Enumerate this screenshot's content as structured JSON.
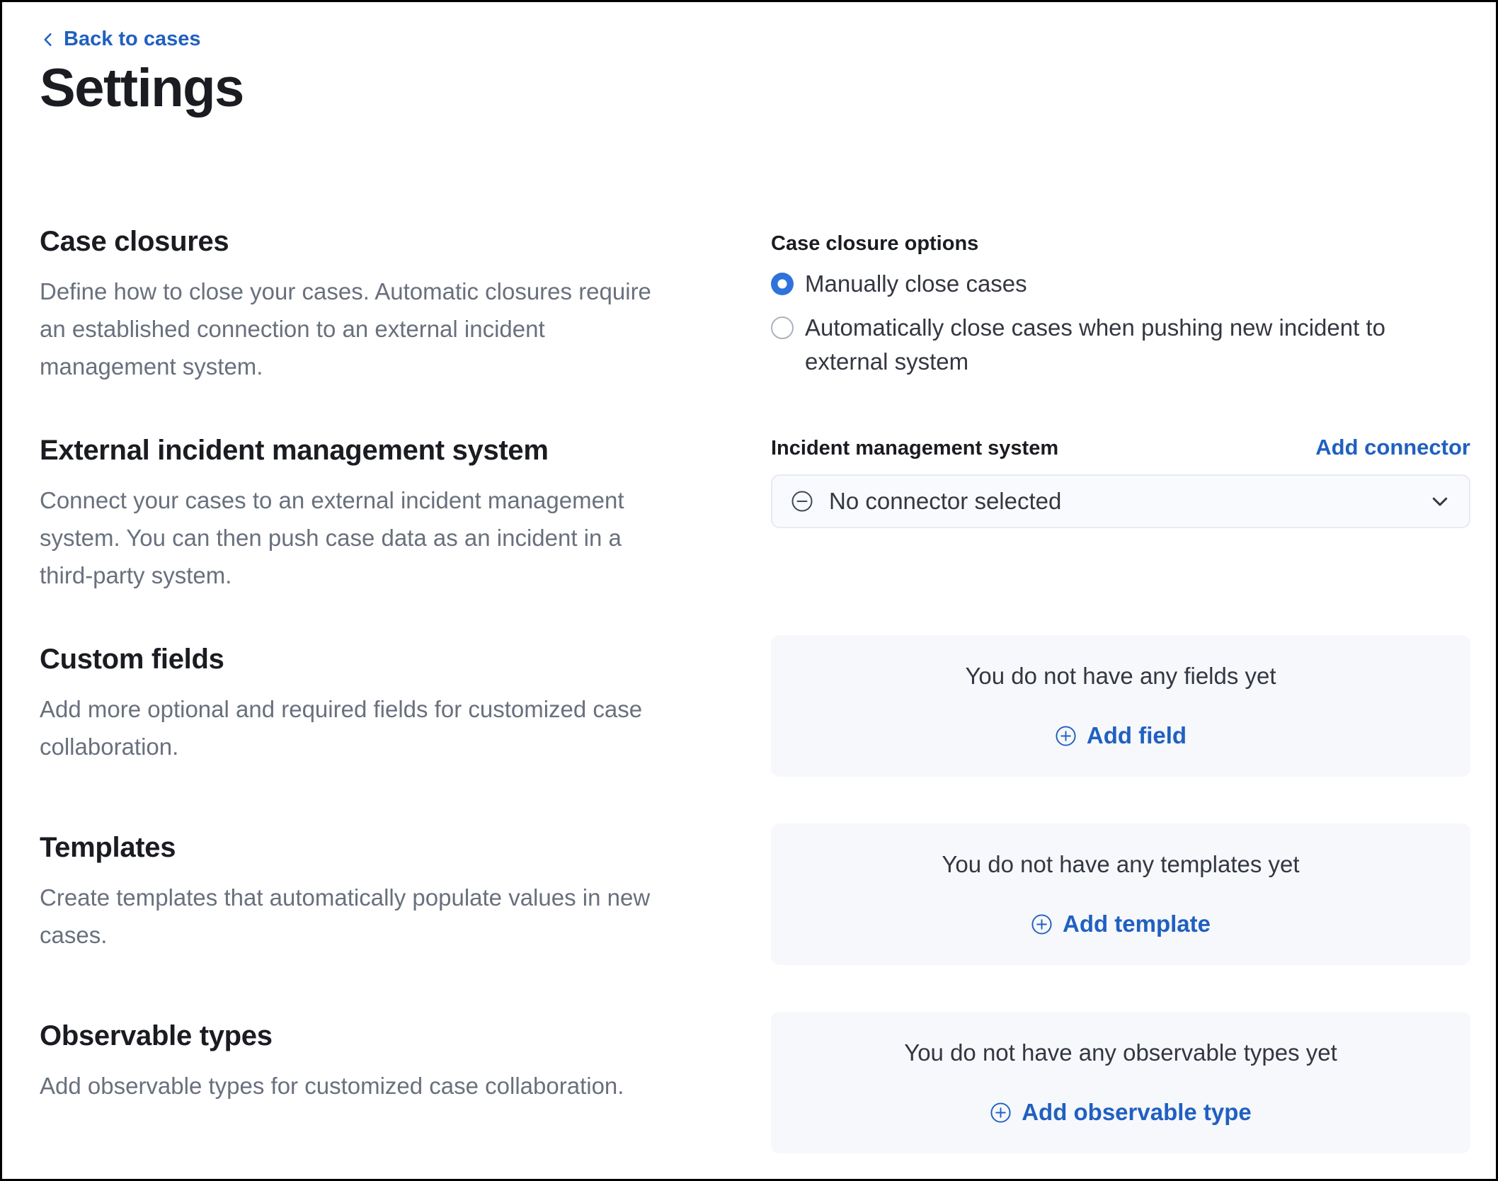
{
  "header": {
    "back_label": "Back to cases",
    "title": "Settings"
  },
  "colors": {
    "link_blue": "#2060C0",
    "radio_selected_blue": "#2E73D9",
    "panel_background": "#F6F8FC",
    "heading_text": "#1A1C21",
    "body_text": "#343741",
    "subdued_text": "#69707D"
  },
  "sections": {
    "case_closures": {
      "heading": "Case closures",
      "description": "Define how to close your cases. Automatic closures require an established connection to an external incident management system.",
      "options_label": "Case closure options",
      "radios": [
        {
          "label": "Manually close cases",
          "selected": true
        },
        {
          "label": "Automatically close cases when pushing new incident to external system",
          "selected": false
        }
      ]
    },
    "external_system": {
      "heading": "External incident management system",
      "description": "Connect your cases to an external incident management system. You can then push case data as an incident in a third-party system.",
      "field_label": "Incident management system",
      "add_connector_label": "Add connector",
      "selected_value": "No connector selected"
    },
    "custom_fields": {
      "heading": "Custom fields",
      "description": "Add more optional and required fields for customized case collaboration.",
      "empty_message": "You do not have any fields yet",
      "add_label": "Add field"
    },
    "templates": {
      "heading": "Templates",
      "description": "Create templates that automatically populate values in new cases.",
      "empty_message": "You do not have any templates yet",
      "add_label": "Add template"
    },
    "observable_types": {
      "heading": "Observable types",
      "description": "Add observable types for customized case collaboration.",
      "empty_message": "You do not have any observable types yet",
      "add_label": "Add observable type"
    }
  }
}
